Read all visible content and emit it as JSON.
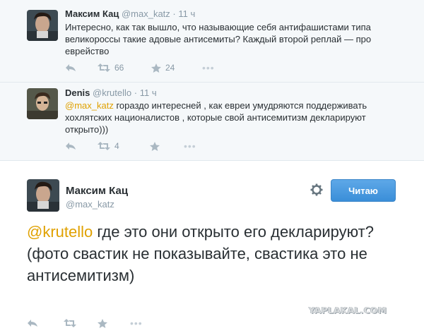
{
  "replies": [
    {
      "fullname": "Максим Кац",
      "handle": "@max_katz",
      "dot": "·",
      "time": "11 ч",
      "text": "Интересно, как так вышло, что называющие себя антифашистами типа великороссы такие адовые антисемиты? Каждый второй реплай — про еврейство",
      "retweets": "66",
      "favorites": "24",
      "avatar_icon": "user-avatar"
    },
    {
      "fullname": "Denis",
      "handle": "@krutello",
      "dot": "·",
      "time": "11 ч",
      "mention": "@max_katz",
      "text": " гораздо интересней , как евреи умудряются поддерживать хохлятских националистов , которые свой антисемитизм декларируют открыто)))",
      "retweets": "4",
      "favorites": "",
      "avatar_icon": "user-avatar"
    }
  ],
  "main": {
    "fullname": "Максим Кац",
    "handle": "@max_katz",
    "follow_label": "Читаю",
    "mention": "@krutello",
    "text": " где это они открыто его декларируют? (фото свастик не показывайте, свастика это не антисемитизм)"
  },
  "watermark": "YAPLAKAL.COM",
  "colors": {
    "mention": "#e0a100",
    "button": "#4a9ae0",
    "reply_bg": "#f5f8fa",
    "muted": "#8899a6"
  },
  "icons": [
    "reply-icon",
    "retweet-icon",
    "favorite-icon",
    "more-icon",
    "gear-icon"
  ]
}
